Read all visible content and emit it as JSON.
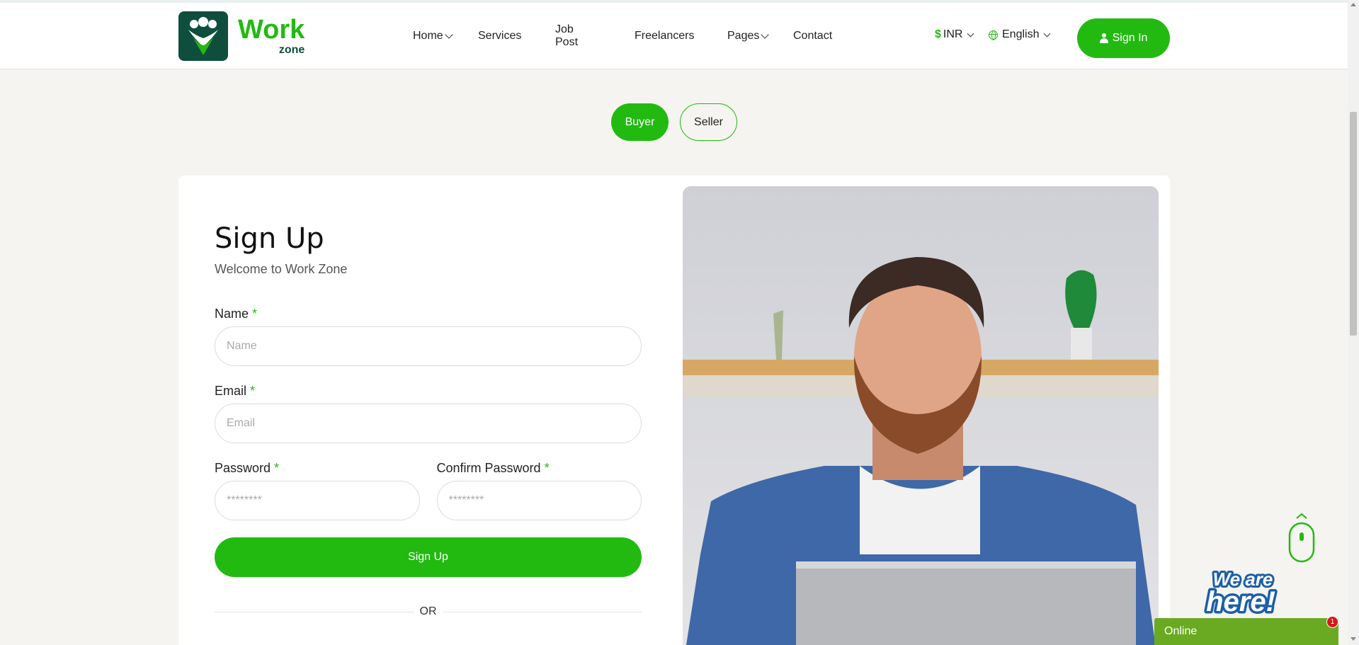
{
  "brand": {
    "name_main": "Work",
    "name_sub": "zone"
  },
  "nav": {
    "items": [
      {
        "label": "Home",
        "dropdown": true
      },
      {
        "label": "Services",
        "dropdown": false
      },
      {
        "label": "Job Post",
        "dropdown": false
      },
      {
        "label": "Freelancers",
        "dropdown": false
      },
      {
        "label": "Pages",
        "dropdown": true
      },
      {
        "label": "Contact",
        "dropdown": false
      }
    ]
  },
  "header": {
    "currency_symbol": "$",
    "currency": "INR",
    "language": "English",
    "signin_label": "Sign In"
  },
  "role_toggle": {
    "buyer": "Buyer",
    "seller": "Seller",
    "selected": "Buyer"
  },
  "form": {
    "title": "Sign Up",
    "subtitle": "Welcome to Work Zone",
    "required_mark": "*",
    "name_label": "Name",
    "name_placeholder": "Name",
    "email_label": "Email",
    "email_placeholder": "Email",
    "password_label": "Password",
    "password_placeholder": "********",
    "confirm_label": "Confirm Password",
    "confirm_placeholder": "********",
    "submit_label": "Sign Up",
    "or_label": "OR"
  },
  "chat": {
    "banner_text": "We are here!",
    "status": "Online",
    "badge_count": "1"
  },
  "colors": {
    "accent": "#22ba11",
    "brand_dark": "#0f4e3d",
    "chat_bar": "#6aaa22"
  }
}
